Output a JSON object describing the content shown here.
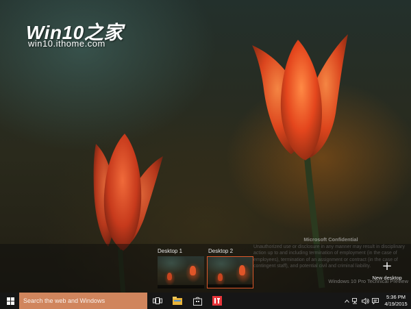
{
  "watermark": {
    "title": "Win10之家",
    "url": "win10.ithome.com"
  },
  "task_view": {
    "desktops": [
      {
        "label": "Desktop 1",
        "active": false
      },
      {
        "label": "Desktop 2",
        "active": true
      }
    ],
    "new_desktop_label": "New desktop",
    "new_desktop_glyph": "+"
  },
  "confidential": {
    "title": "Microsoft Confidential",
    "body": "Unauthorized use or disclosure in any manner may result in disciplinary action up to and including termination of employment (in the case of employees), termination of an assignment or contract (in the case of contingent staff), and potential civil and criminal liability."
  },
  "edition": "Windows 10 Pro Technical Preview",
  "taskbar": {
    "search_placeholder": "Search the web and Windows",
    "pinned_icons": [
      "task-view-icon",
      "file-explorer-icon",
      "store-icon",
      "app-icon"
    ],
    "tray_icons": [
      "chevron-up-icon",
      "network-icon",
      "volume-icon",
      "action-center-icon"
    ],
    "clock_time": "5:36 PM",
    "clock_date": "4/19/2015",
    "accent_color": "#d0855d",
    "app_icon_color": "#e8353a"
  }
}
